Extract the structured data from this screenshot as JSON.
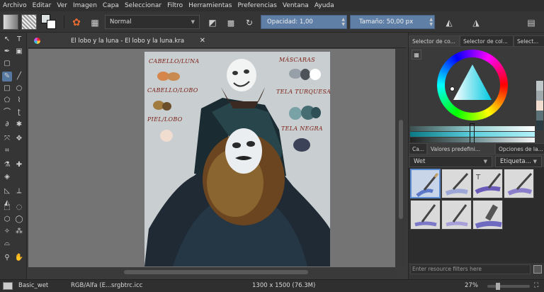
{
  "menu": [
    "Archivo",
    "Editar",
    "Ver",
    "Imagen",
    "Capa",
    "Seleccionar",
    "Filtro",
    "Herramientas",
    "Preferencias",
    "Ventana",
    "Ayuda"
  ],
  "toolbar": {
    "blend_mode": "Normal",
    "opacity_label": "Opacidad:",
    "opacity_value": "1,00",
    "size_label": "Tamaño:",
    "size_value": "50,00 px",
    "opacity_fraction": 1.0
  },
  "document": {
    "tab_title": "El lobo y la luna - El lobo y la luna.kra"
  },
  "painting": {
    "notes": {
      "cabello_luna": "CABELLO/LUNA",
      "mascaras": "MÁSCARAS",
      "cabello_lobo": "CABELLO/LOBO",
      "tela_turquesa": "TELA TURQUESA",
      "piel_lobo": "PIEL/LOBO",
      "tela_negra": "TELA NEGRA"
    },
    "colors": {
      "cabello_luna": [
        "#d5864b",
        "#c98a51"
      ],
      "cabello_lobo": [
        "#a27c3e",
        "#6b4e2a"
      ],
      "piel_lobo": "#f1dcd0",
      "mascaras": [
        "#97a0a8",
        "#4e5359",
        "#ffffff"
      ],
      "tela_turquesa": [
        "#79a2a6",
        "#466e72",
        "#2f4f56"
      ],
      "tela_negra": "#3c4358"
    }
  },
  "right_dock": {
    "top_tabs": [
      "Selector de co...",
      "Selector de col...",
      "Select..."
    ],
    "bottom_tabs": [
      "Ca...",
      "Valores predefini...",
      "Opciones de la..."
    ],
    "preset_tag": "Wet",
    "tag_label": "Etiqueta...",
    "filter_placeholder": "Enter resource filters here"
  },
  "status": {
    "preset": "Basic_wet",
    "color_space": "RGB/Alfa (E...srgbtrc.icc",
    "dimensions": "1300 x 1500 (76.3M)",
    "zoom": "27%"
  },
  "icons": {
    "tools": [
      "select-arrow-icon",
      "text-icon",
      "calligraphy-icon",
      "gradient-icon",
      "brush-icon",
      "line-icon",
      "rectangle-icon",
      "ellipse-icon",
      "polygon-icon",
      "polyline-icon",
      "bezier-icon",
      "freehand-path-icon",
      "dynamic-brush-icon",
      "multibrush-icon",
      "transform-icon",
      "move-icon",
      "crop-icon",
      "eyedropper-icon",
      "fill-icon",
      "assistant-icon",
      "measure-icon",
      "rect-select-icon",
      "ellipse-select-icon",
      "poly-select-icon",
      "freehand-select-icon",
      "contiguous-select-icon",
      "similar-select-icon",
      "bezier-select-icon",
      "magnetic-select-icon",
      "zoom-icon",
      "pan-icon"
    ]
  }
}
